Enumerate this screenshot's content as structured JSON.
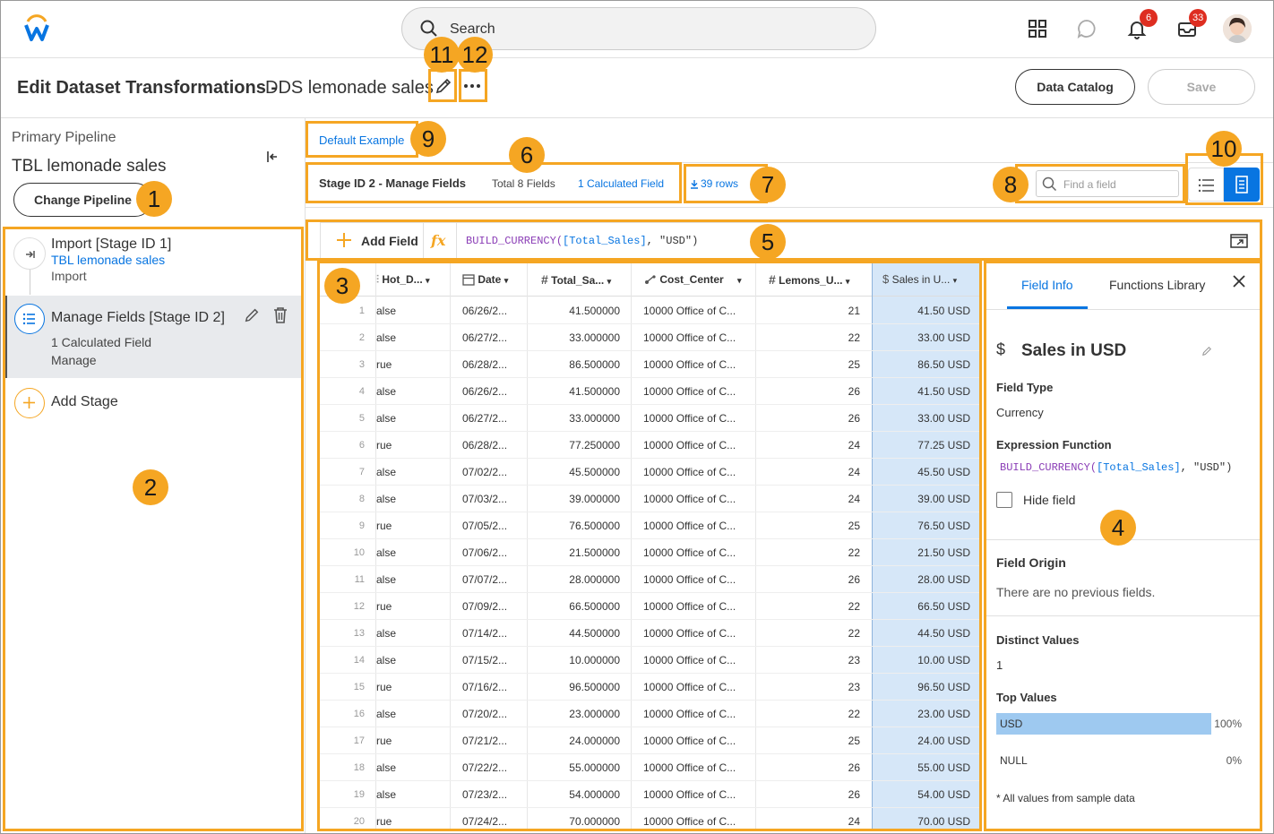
{
  "app": {
    "search_placeholder": "Search",
    "notifications_count": "6",
    "inbox_count": "33"
  },
  "header": {
    "title": "Edit Dataset Transformations -",
    "dataset_name": "DDS lemonade sales",
    "data_catalog_label": "Data Catalog",
    "save_label": "Save"
  },
  "sidebar": {
    "pipeline_label": "Primary Pipeline",
    "pipeline_name": "TBL lemonade sales",
    "change_pipeline_label": "Change Pipeline",
    "stages": [
      {
        "title": "Import [Stage ID 1]",
        "link": "TBL lemonade sales",
        "type": "Import"
      },
      {
        "title": "Manage Fields [Stage ID 2]",
        "detail": "1 Calculated Field",
        "type": "Manage"
      }
    ],
    "add_stage_label": "Add Stage"
  },
  "example": {
    "label": "Default Example"
  },
  "stage_bar": {
    "stage_title": "Stage ID 2 - Manage Fields",
    "total_fields": "Total 8 Fields",
    "calculated": "1 Calculated Field",
    "rows": "39 rows",
    "find_placeholder": "Find a field"
  },
  "formula_bar": {
    "add_field_label": "Add Field",
    "fx": "fx",
    "expression_prefix": "BUILD_CURRENCY(",
    "expression_field": "[Total_Sales]",
    "expression_suffix": ", \"USD\")"
  },
  "table": {
    "columns": [
      "Hot_D...",
      "Date",
      "Total_Sa...",
      "Cost_Center",
      "Lemons_U...",
      "Sales in U..."
    ],
    "rows": [
      {
        "n": "1",
        "hot": "alse",
        "date": "06/26/2...",
        "total": "41.500000",
        "cc": "10000 Office of C...",
        "lemons": "21",
        "sales": "41.50 USD"
      },
      {
        "n": "2",
        "hot": "alse",
        "date": "06/27/2...",
        "total": "33.000000",
        "cc": "10000 Office of C...",
        "lemons": "22",
        "sales": "33.00 USD"
      },
      {
        "n": "3",
        "hot": "rue",
        "date": "06/28/2...",
        "total": "86.500000",
        "cc": "10000 Office of C...",
        "lemons": "25",
        "sales": "86.50 USD"
      },
      {
        "n": "4",
        "hot": "alse",
        "date": "06/26/2...",
        "total": "41.500000",
        "cc": "10000 Office of C...",
        "lemons": "26",
        "sales": "41.50 USD"
      },
      {
        "n": "5",
        "hot": "alse",
        "date": "06/27/2...",
        "total": "33.000000",
        "cc": "10000 Office of C...",
        "lemons": "26",
        "sales": "33.00 USD"
      },
      {
        "n": "6",
        "hot": "rue",
        "date": "06/28/2...",
        "total": "77.250000",
        "cc": "10000 Office of C...",
        "lemons": "24",
        "sales": "77.25 USD"
      },
      {
        "n": "7",
        "hot": "alse",
        "date": "07/02/2...",
        "total": "45.500000",
        "cc": "10000 Office of C...",
        "lemons": "24",
        "sales": "45.50 USD"
      },
      {
        "n": "8",
        "hot": "alse",
        "date": "07/03/2...",
        "total": "39.000000",
        "cc": "10000 Office of C...",
        "lemons": "24",
        "sales": "39.00 USD"
      },
      {
        "n": "9",
        "hot": "rue",
        "date": "07/05/2...",
        "total": "76.500000",
        "cc": "10000 Office of C...",
        "lemons": "25",
        "sales": "76.50 USD"
      },
      {
        "n": "10",
        "hot": "alse",
        "date": "07/06/2...",
        "total": "21.500000",
        "cc": "10000 Office of C...",
        "lemons": "22",
        "sales": "21.50 USD"
      },
      {
        "n": "11",
        "hot": "alse",
        "date": "07/07/2...",
        "total": "28.000000",
        "cc": "10000 Office of C...",
        "lemons": "26",
        "sales": "28.00 USD"
      },
      {
        "n": "12",
        "hot": "rue",
        "date": "07/09/2...",
        "total": "66.500000",
        "cc": "10000 Office of C...",
        "lemons": "22",
        "sales": "66.50 USD"
      },
      {
        "n": "13",
        "hot": "alse",
        "date": "07/14/2...",
        "total": "44.500000",
        "cc": "10000 Office of C...",
        "lemons": "22",
        "sales": "44.50 USD"
      },
      {
        "n": "14",
        "hot": "alse",
        "date": "07/15/2...",
        "total": "10.000000",
        "cc": "10000 Office of C...",
        "lemons": "23",
        "sales": "10.00 USD"
      },
      {
        "n": "15",
        "hot": "rue",
        "date": "07/16/2...",
        "total": "96.500000",
        "cc": "10000 Office of C...",
        "lemons": "23",
        "sales": "96.50 USD"
      },
      {
        "n": "16",
        "hot": "alse",
        "date": "07/20/2...",
        "total": "23.000000",
        "cc": "10000 Office of C...",
        "lemons": "22",
        "sales": "23.00 USD"
      },
      {
        "n": "17",
        "hot": "rue",
        "date": "07/21/2...",
        "total": "24.000000",
        "cc": "10000 Office of C...",
        "lemons": "25",
        "sales": "24.00 USD"
      },
      {
        "n": "18",
        "hot": "alse",
        "date": "07/22/2...",
        "total": "55.000000",
        "cc": "10000 Office of C...",
        "lemons": "26",
        "sales": "55.00 USD"
      },
      {
        "n": "19",
        "hot": "alse",
        "date": "07/23/2...",
        "total": "54.000000",
        "cc": "10000 Office of C...",
        "lemons": "26",
        "sales": "54.00 USD"
      },
      {
        "n": "20",
        "hot": "rue",
        "date": "07/24/2...",
        "total": "70.000000",
        "cc": "10000 Office of C...",
        "lemons": "24",
        "sales": "70.00 USD"
      }
    ]
  },
  "field_panel": {
    "tabs": [
      "Field Info",
      "Functions Library"
    ],
    "field_name": "Sales in USD",
    "field_type_label": "Field Type",
    "field_type": "Currency",
    "expression_label": "Expression Function",
    "hide_field_label": "Hide field",
    "origin_label": "Field Origin",
    "origin_text": "There are no previous fields.",
    "distinct_label": "Distinct Values",
    "distinct_value": "1",
    "top_values_label": "Top Values",
    "top_values": [
      {
        "label": "USD",
        "pct": "100%",
        "fraction": 1.0
      },
      {
        "label": "NULL",
        "pct": "0%",
        "fraction": 0.0
      }
    ],
    "footnote": "* All values from sample data"
  },
  "callouts": [
    "1",
    "2",
    "3",
    "4",
    "5",
    "6",
    "7",
    "8",
    "9",
    "10",
    "11",
    "12"
  ],
  "colors": {
    "accent": "#f5a623",
    "link": "#0875e1",
    "selected_col": "#d6e7f8",
    "primary": "#0875e1"
  }
}
